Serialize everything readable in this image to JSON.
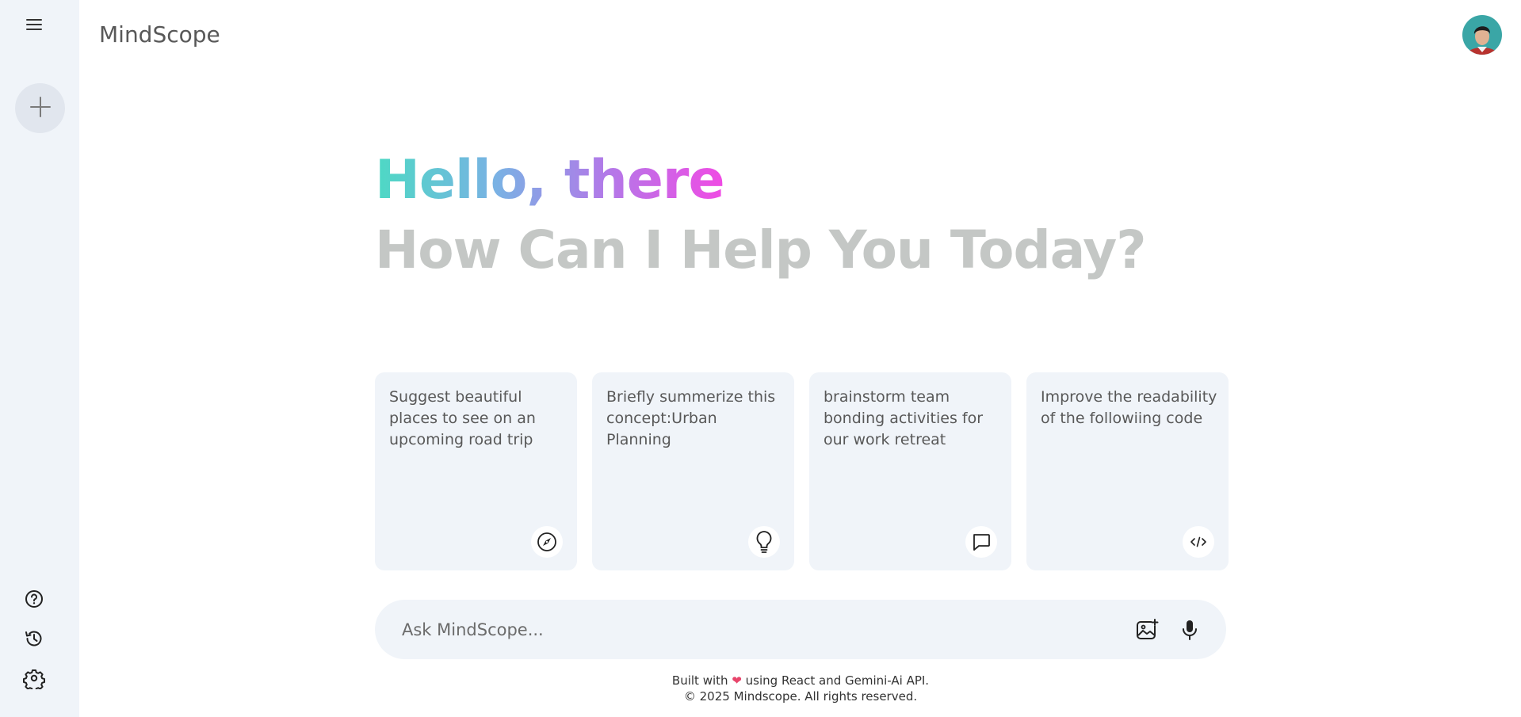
{
  "app": {
    "brand": "MindScope"
  },
  "sidebar": {
    "menu_icon": "hamburger-icon",
    "new_chat_icon": "plus-icon",
    "bottom_icons": [
      "help-icon",
      "history-icon",
      "settings-icon"
    ]
  },
  "header": {
    "avatar": "user-avatar"
  },
  "greeting": {
    "hello": "Hello, there",
    "subtitle": "How Can I Help You Today?"
  },
  "cards": [
    {
      "text": "Suggest beautiful places to see on an upcoming road trip",
      "icon": "compass-icon"
    },
    {
      "text": "Briefly summerize this concept:Urban Planning",
      "icon": "bulb-icon"
    },
    {
      "text": "brainstorm team bonding activities for our work retreat",
      "icon": "message-icon"
    },
    {
      "text": "Improve the readability of the followiing code",
      "icon": "code-icon"
    }
  ],
  "search": {
    "placeholder": "Ask MindScope...",
    "value": "",
    "icons": [
      "gallery-icon",
      "mic-icon"
    ]
  },
  "footer": {
    "line1_before": "Built with",
    "line1_heart": "❤",
    "line1_after": "using React and Gemini-Ai API.",
    "line2": "© 2025 Mindscope. All rights reserved."
  },
  "colors": {
    "sidebar_bg": "#f0f4f9",
    "card_bg": "#f0f4f9",
    "subtitle": "#c4c7c5",
    "gradient": [
      "#4dd9c4",
      "#7ab1e4",
      "#b07be8",
      "#f04be4"
    ]
  }
}
